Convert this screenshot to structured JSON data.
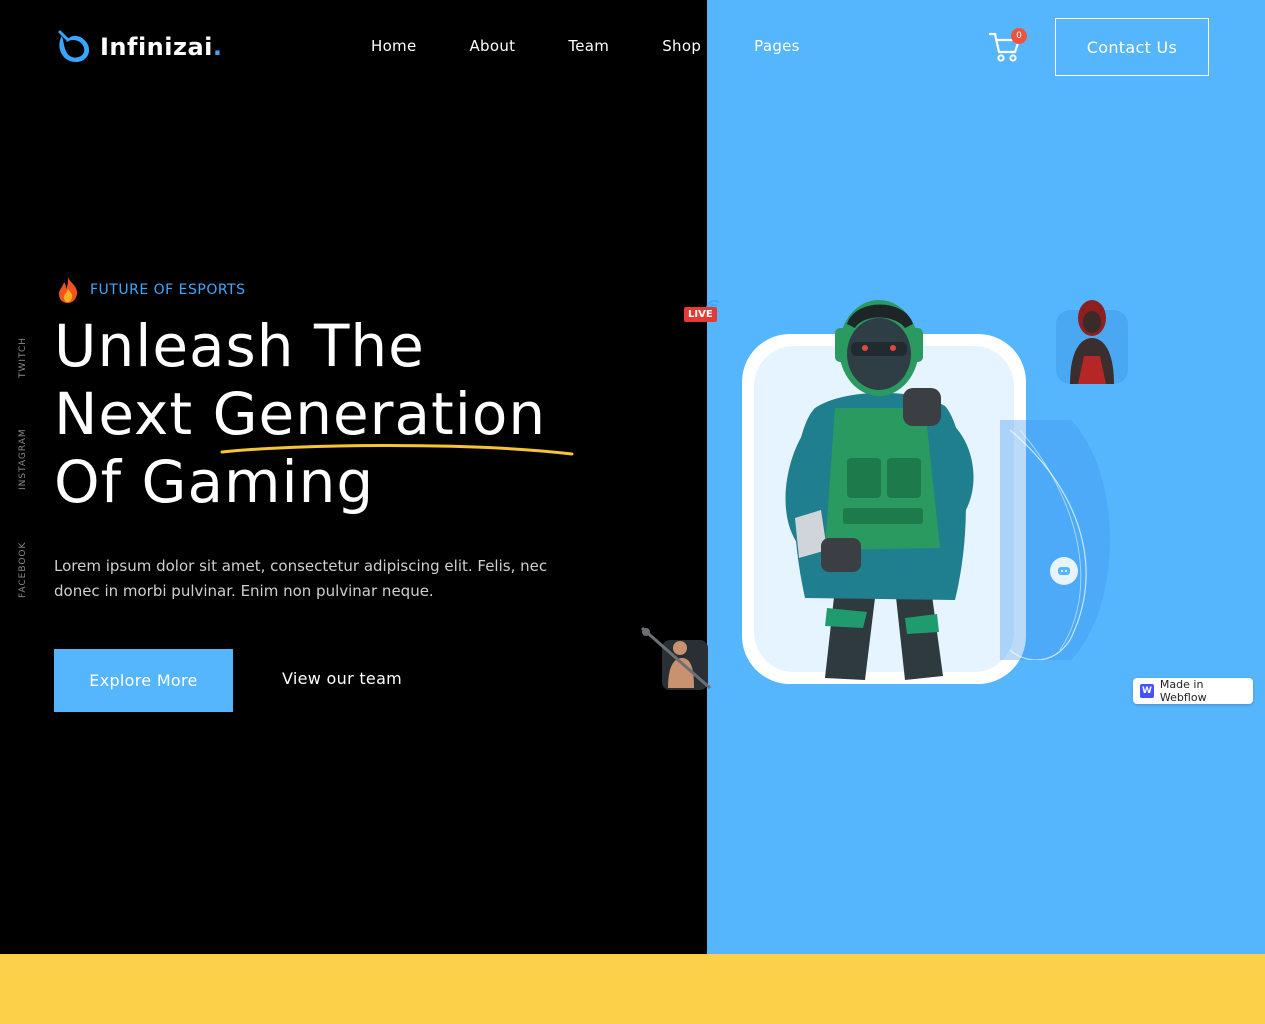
{
  "brand": {
    "name": "Infinizai",
    "dot": ".",
    "accent": "#36a6ff"
  },
  "nav": {
    "items": [
      {
        "label": "Home"
      },
      {
        "label": "About"
      },
      {
        "label": "Team"
      },
      {
        "label": "Shop"
      },
      {
        "label": "Pages"
      }
    ]
  },
  "cart": {
    "count": "0",
    "icon": "cart-icon"
  },
  "header": {
    "contact_label": "Contact Us"
  },
  "social": {
    "twitch": "TWITCH",
    "instagram": "INSTAGRAM",
    "facebook": "FACEBOOK"
  },
  "hero": {
    "tagline": "FUTURE OF ESPORTS",
    "headline_line1": "Unleash The",
    "headline_line2_a": "Next ",
    "headline_line2_b": "Generation",
    "headline_line3": "Of Gaming",
    "description": "Lorem ipsum dolor sit amet, consectetur adipiscing elit. Felis, nec donec in morbi pulvinar. Enim non pulvinar neque.",
    "explore_label": "Explore More",
    "team_label": "View our team",
    "live_label": "LIVE"
  },
  "webflow": {
    "label": "Made in Webflow",
    "logo": "W"
  },
  "colors": {
    "background": "#000000",
    "panel_blue": "#55b6fd",
    "band_yellow": "#fdd04a",
    "accent_blue": "#3fa9ff",
    "underline_yellow": "#f7c531"
  }
}
